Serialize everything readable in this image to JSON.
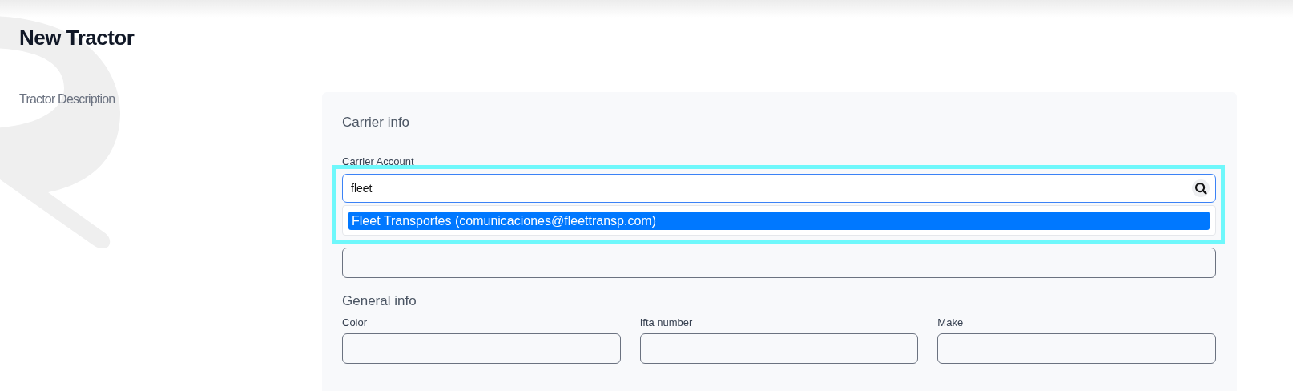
{
  "page": {
    "title": "New Tractor",
    "description": "Tractor Description"
  },
  "carrier_info": {
    "heading": "Carrier info",
    "account_label": "Carrier Account",
    "search": {
      "value": "fleet"
    },
    "suggestions": [
      {
        "label": "Fleet Transportes (comunicaciones@fleettransp.com)",
        "selected": true
      }
    ]
  },
  "general_info": {
    "heading": "General info",
    "fields": [
      {
        "label": "Color"
      },
      {
        "label": "Ifta number"
      },
      {
        "label": "Make"
      }
    ]
  }
}
